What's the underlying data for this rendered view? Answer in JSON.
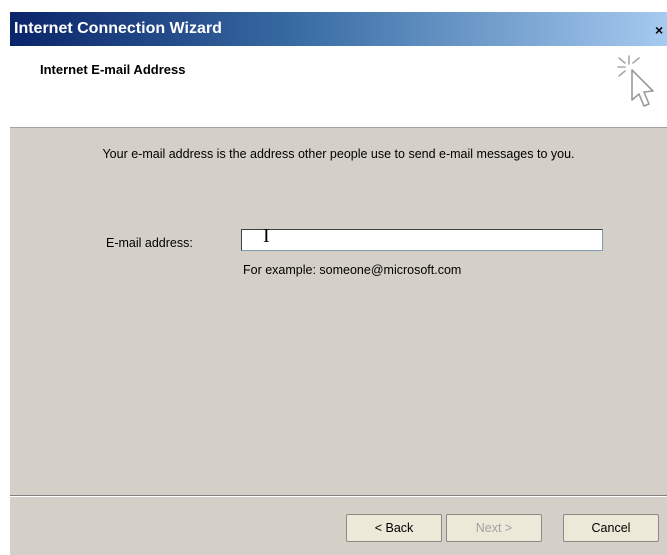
{
  "window": {
    "title": "Internet Connection Wizard",
    "close_label": "×"
  },
  "header": {
    "title": "Internet E-mail Address",
    "icon": "wizard-cursor-sparkle-icon"
  },
  "main": {
    "description": "Your e-mail address is the address other people use to send e-mail messages to you.",
    "email_label": "E-mail address:",
    "email_value": "",
    "example": "For example: someone@microsoft.com"
  },
  "buttons": {
    "back": "< Back",
    "next": "Next >",
    "cancel": "Cancel"
  },
  "colors": {
    "titlebar_start": "#0a246a",
    "titlebar_end": "#a6caf0",
    "dialog_bg": "#d4d0c8"
  }
}
